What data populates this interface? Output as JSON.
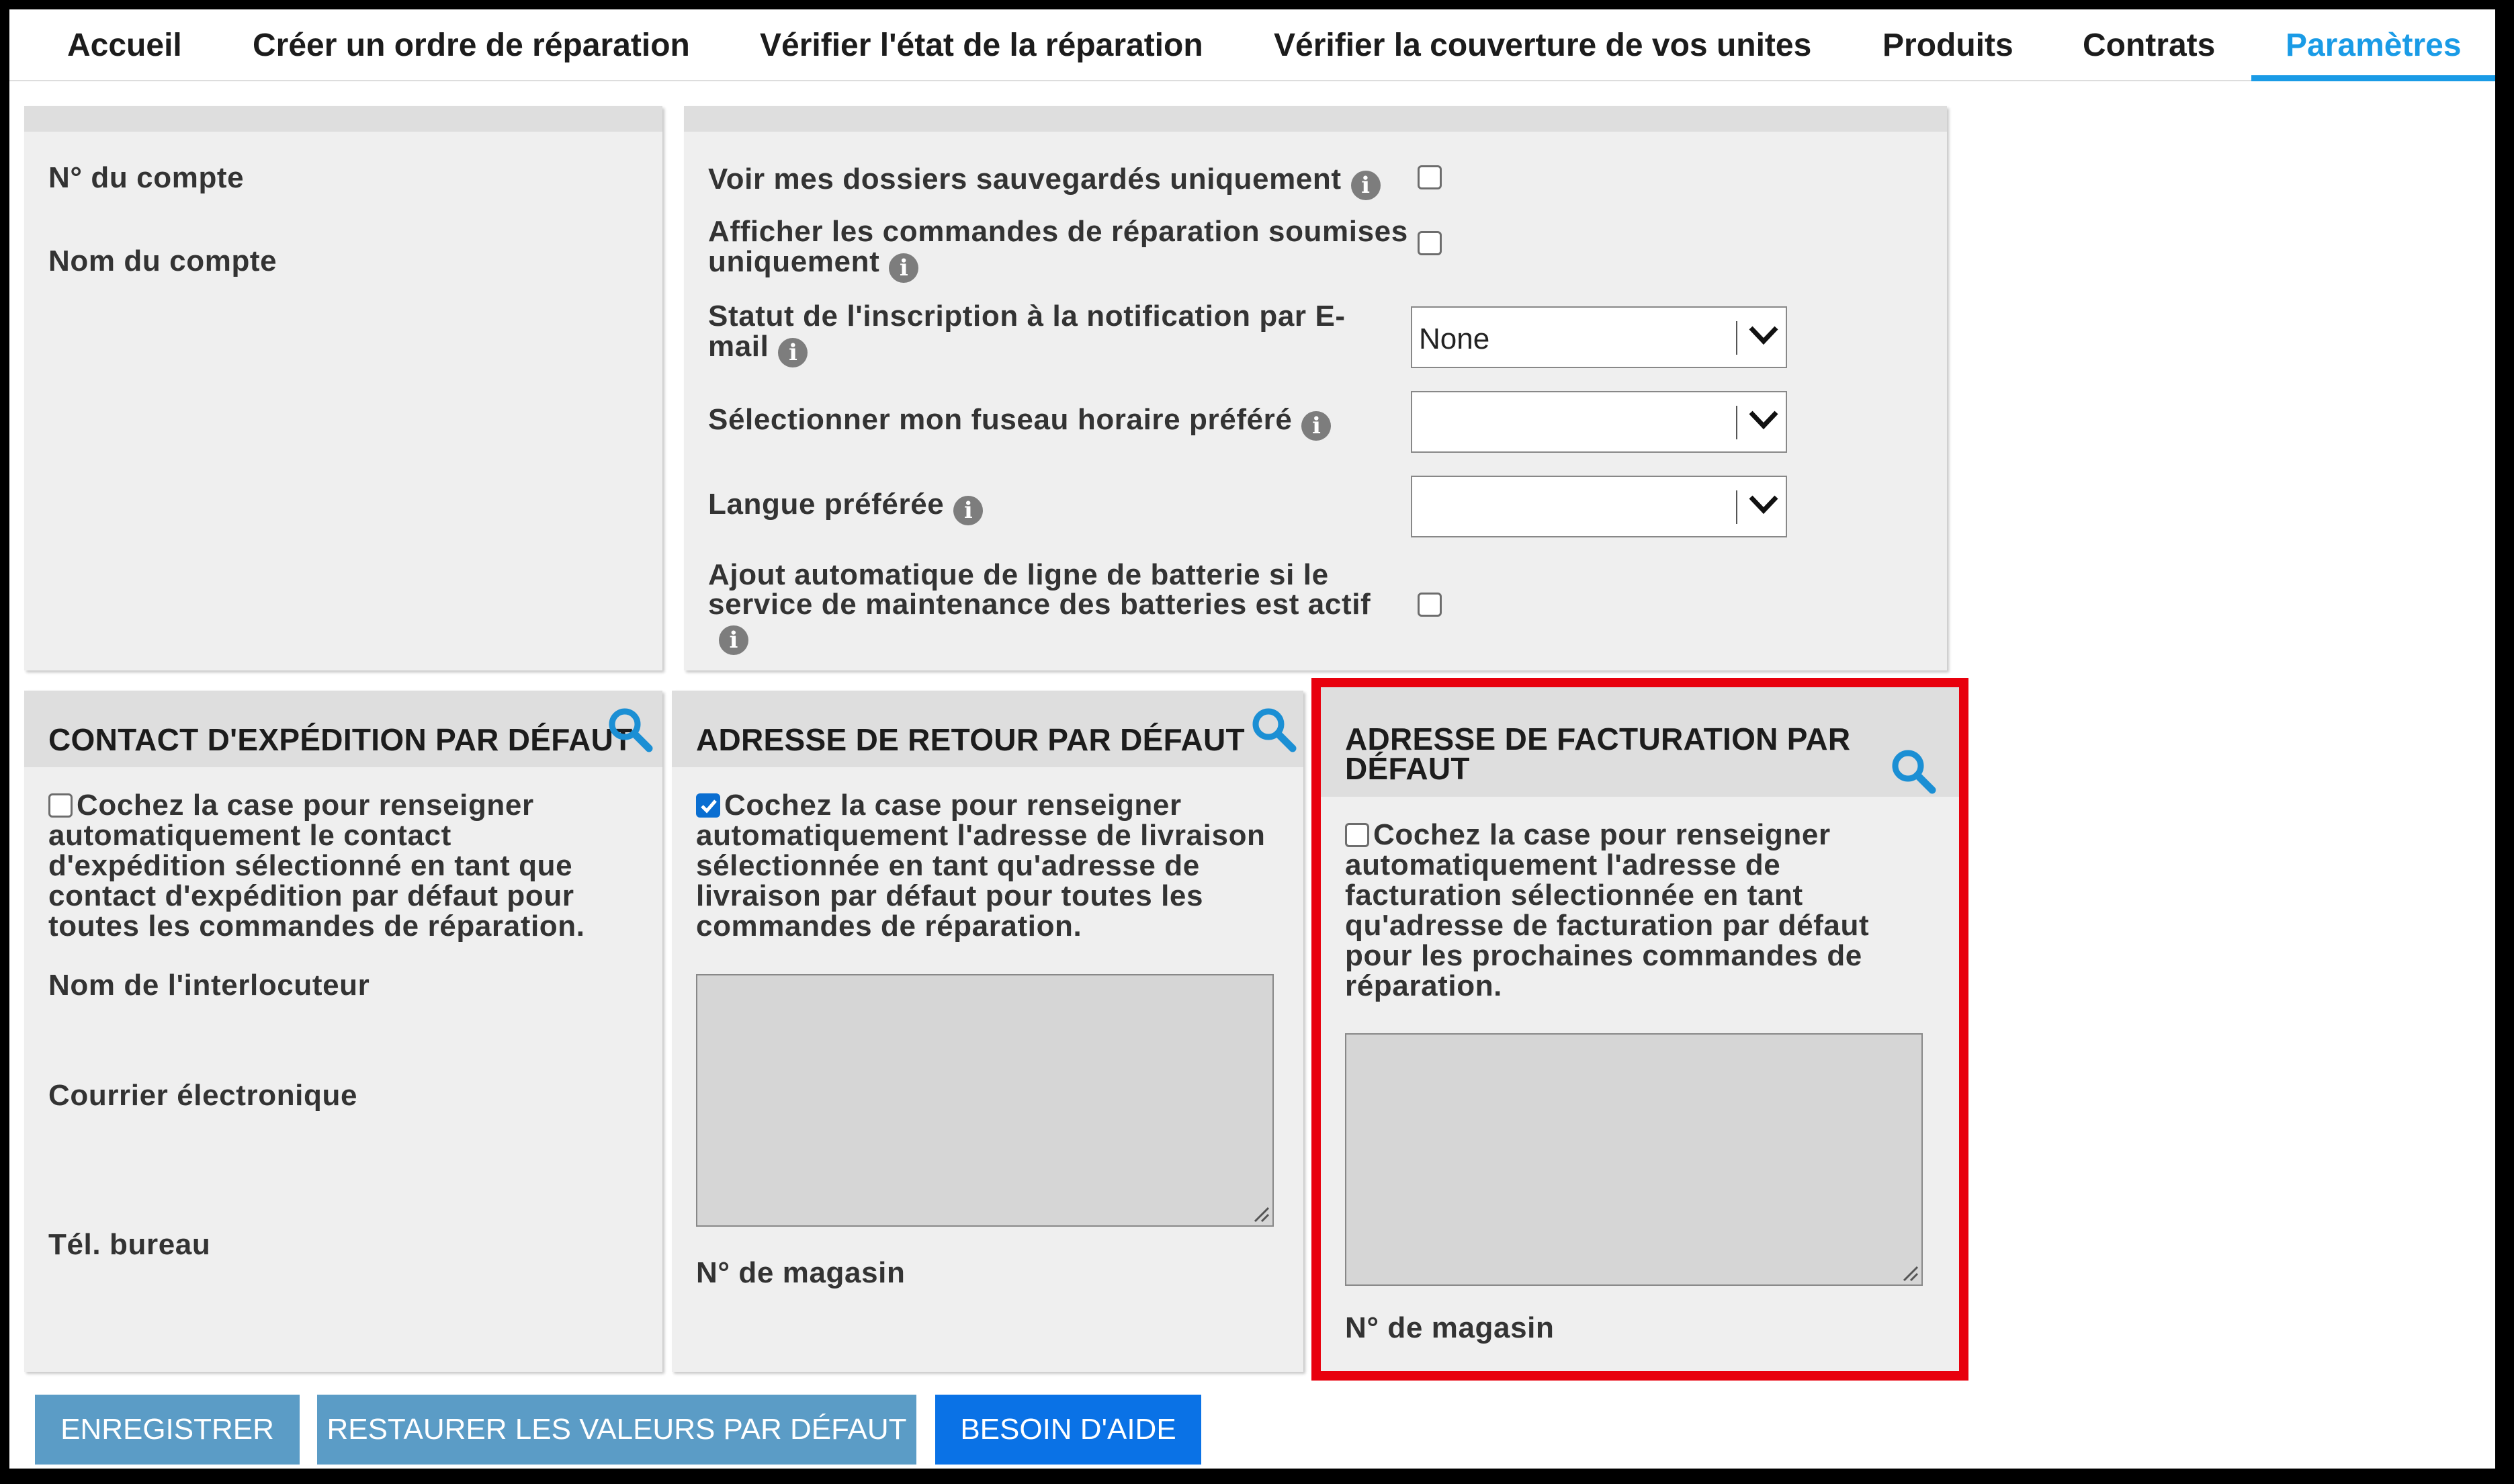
{
  "nav": {
    "tabs": [
      {
        "label": "Accueil"
      },
      {
        "label": "Créer un ordre de réparation"
      },
      {
        "label": "Vérifier l'état de la réparation"
      },
      {
        "label": "Vérifier la couverture de vos unites"
      },
      {
        "label": "Produits"
      },
      {
        "label": "Contrats"
      },
      {
        "label": "Paramètres",
        "active": true
      }
    ]
  },
  "account": {
    "number_label": "N° du compte",
    "name_label": "Nom du compte"
  },
  "preferences": {
    "saved_only_label": "Voir mes dossiers sauvegardés uniquement",
    "submitted_only_line1": "Afficher les commandes de réparation soumises",
    "submitted_only_line2": "uniquement",
    "email_status_line1": "Statut de l'inscription à la notification par E-",
    "email_status_line2": "mail",
    "email_status_value": "None",
    "timezone_label": "Sélectionner mon fuseau horaire préféré",
    "timezone_value": "",
    "language_label": "Langue préférée",
    "language_value": "",
    "battery_line1": "Ajout automatique de ligne de batterie si le",
    "battery_line2": "service de maintenance des batteries est actif",
    "saved_only_checked": false,
    "submitted_only_checked": false,
    "battery_checked": false
  },
  "shipping": {
    "title": "CONTACT D'EXPÉDITION PAR DÉFAUT",
    "checkbox_text": [
      "Cochez la case pour renseigner",
      "automatiquement le contact",
      "d'expédition sélectionné en tant que",
      "contact d'expédition par défaut pour",
      "toutes les commandes de réparation."
    ],
    "checked": false,
    "contact_name_label": "Nom de l'interlocuteur",
    "email_label": "Courrier électronique",
    "phone_label": "Tél. bureau"
  },
  "return": {
    "title": "ADRESSE DE RETOUR PAR DÉFAUT",
    "checkbox_text": [
      "Cochez la case pour renseigner",
      "automatiquement l'adresse de livraison",
      "sélectionnée en tant qu'adresse de",
      "livraison par défaut pour toutes les",
      "commandes de réparation."
    ],
    "checked": true,
    "address_value": "",
    "store_label": "N° de magasin"
  },
  "billing": {
    "title_line1": "ADRESSE DE FACTURATION PAR",
    "title_line2": "DÉFAUT",
    "checkbox_text": [
      "Cochez la case pour renseigner",
      "automatiquement l'adresse de",
      "facturation sélectionnée en tant",
      "qu'adresse de facturation par défaut",
      "pour les prochaines commandes de",
      "réparation."
    ],
    "checked": false,
    "address_value": "",
    "store_label": "N° de magasin"
  },
  "buttons": {
    "save": "ENREGISTRER",
    "restore": "RESTAURER LES VALEURS PAR DÉFAUT",
    "help": "BESOIN D'AIDE"
  },
  "colors": {
    "accent": "#1a9be6",
    "highlight": "#e8000d",
    "button_grey": "#5b9cc6",
    "button_blue": "#0a72e6"
  },
  "icons": {
    "info": "i",
    "search": "magnifier-icon",
    "dropdown": "chevron-down-icon"
  }
}
